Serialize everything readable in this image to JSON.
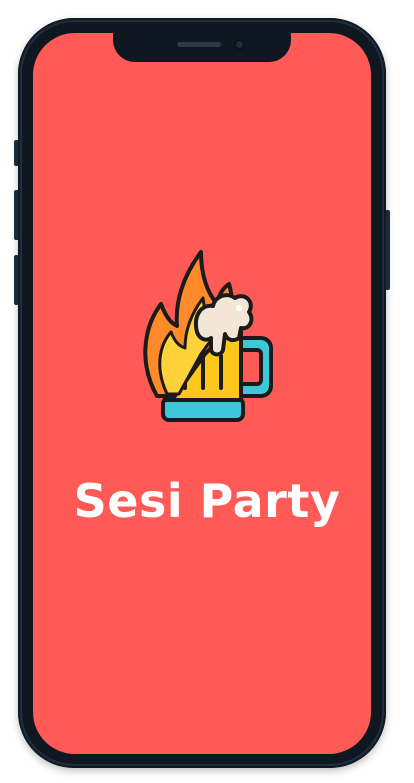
{
  "app": {
    "title": "Sesi Party"
  },
  "logo": {
    "icon": "beer-mug-with-fire-icon"
  },
  "colors": {
    "background": "#ff5a55",
    "device_frame": "#1e2f3d",
    "title_text": "#ffffff",
    "flame_outer": "#ff8a2a",
    "flame_inner": "#ffd23a",
    "beer": "#ffc61b",
    "mug_handle": "#3cc8d8",
    "foam": "#f3e6d6"
  }
}
